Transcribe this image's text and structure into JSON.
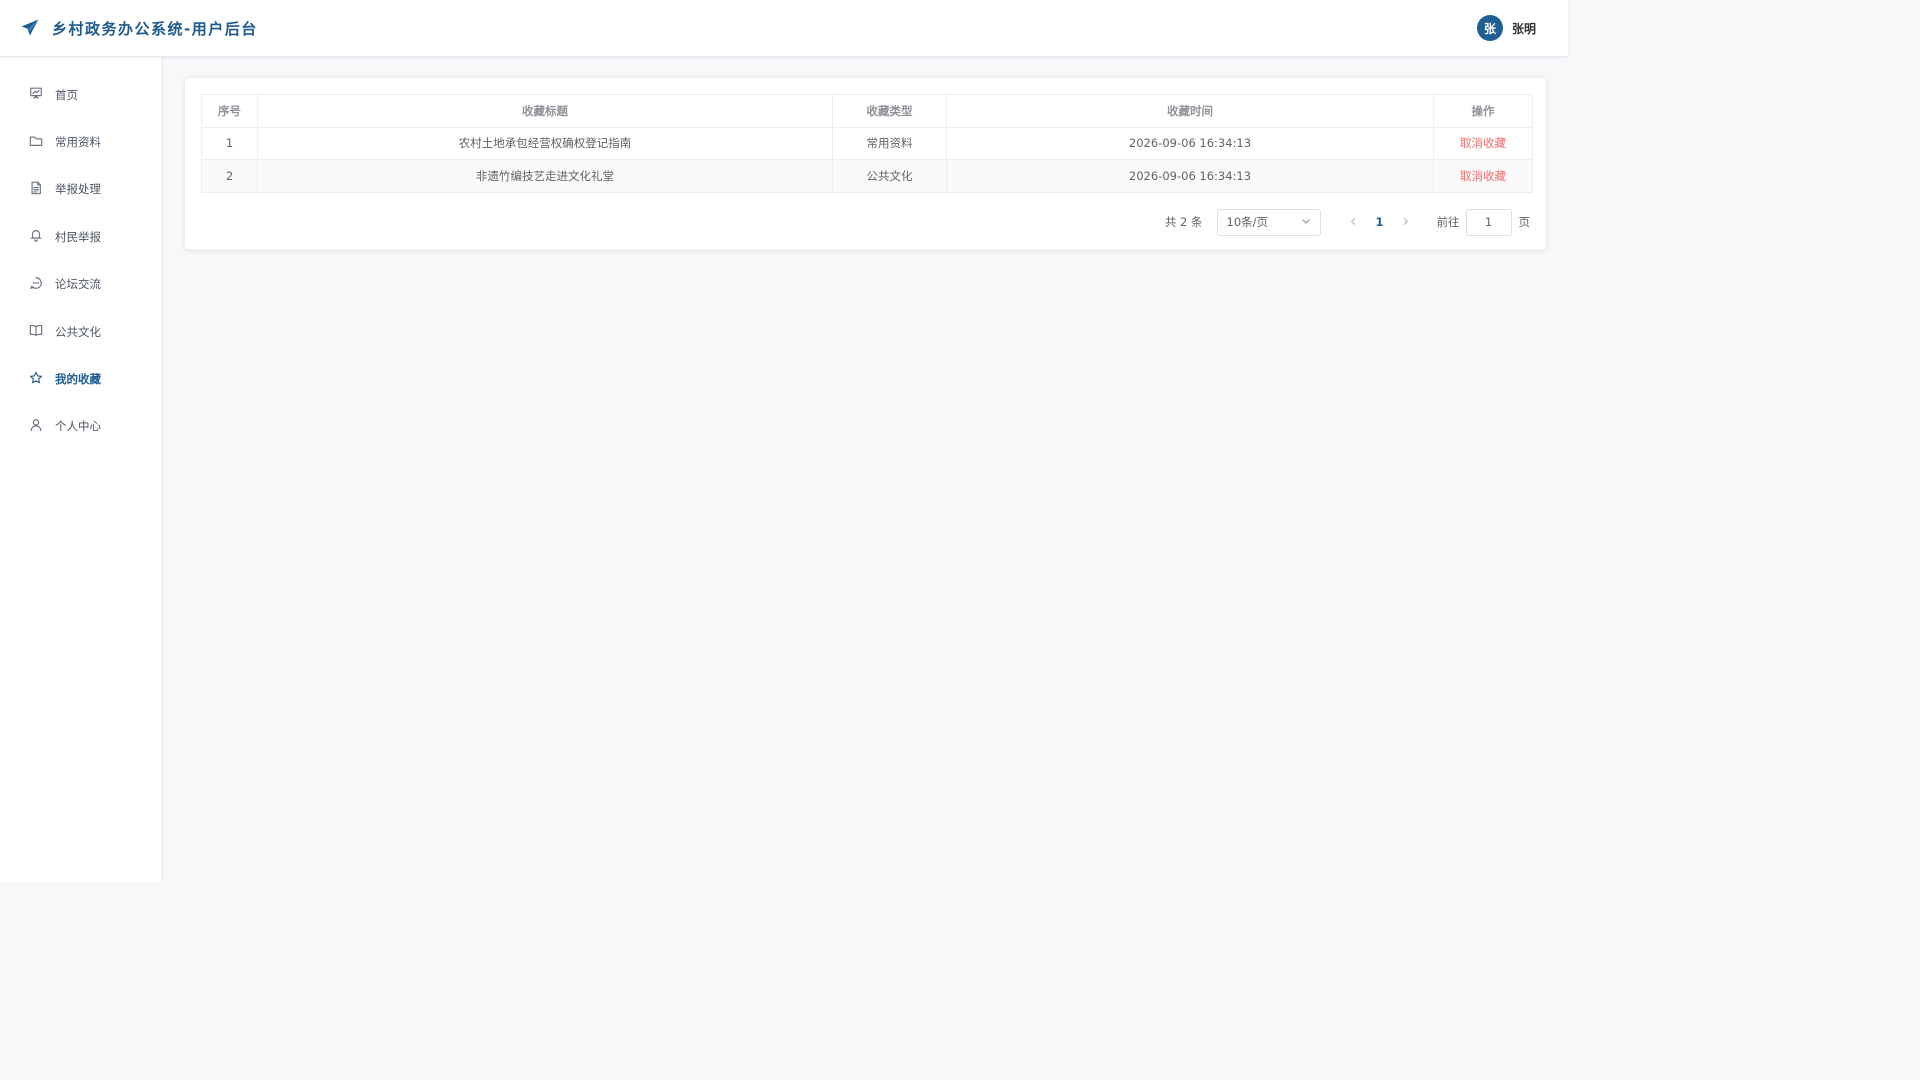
{
  "header": {
    "title": "乡村政务办公系统-用户后台",
    "logo_icon": "paper-plane-icon",
    "user": {
      "avatar_text": "张",
      "name": "张明"
    }
  },
  "sidebar": {
    "items": [
      {
        "label": "首页",
        "icon": "presentation-icon",
        "active": false
      },
      {
        "label": "常用资料",
        "icon": "folder-icon",
        "active": false
      },
      {
        "label": "举报处理",
        "icon": "document-icon",
        "active": false
      },
      {
        "label": "村民举报",
        "icon": "bell-icon",
        "active": false
      },
      {
        "label": "论坛交流",
        "icon": "chat-icon",
        "active": false
      },
      {
        "label": "公共文化",
        "icon": "book-icon",
        "active": false
      },
      {
        "label": "我的收藏",
        "icon": "star-icon",
        "active": true
      },
      {
        "label": "个人中心",
        "icon": "user-icon",
        "active": false
      }
    ]
  },
  "table": {
    "columns": [
      "序号",
      "收藏标题",
      "收藏类型",
      "收藏时间",
      "操作"
    ],
    "rows": [
      {
        "index": "1",
        "title": "农村土地承包经营权确权登记指南",
        "type": "常用资料",
        "time": "2026-09-06 16:34:13",
        "action": "取消收藏"
      },
      {
        "index": "2",
        "title": "非遗竹编技艺走进文化礼堂",
        "type": "公共文化",
        "time": "2026-09-06 16:34:13",
        "action": "取消收藏"
      }
    ]
  },
  "pagination": {
    "total_label": "共 2 条",
    "page_size": "10条/页",
    "current_page": "1",
    "goto_label": "前往",
    "goto_value": "1",
    "goto_suffix": "页"
  },
  "colors": {
    "brand": "#1e5a8c",
    "danger": "#f56c6c",
    "background": "#f7f8fa"
  }
}
